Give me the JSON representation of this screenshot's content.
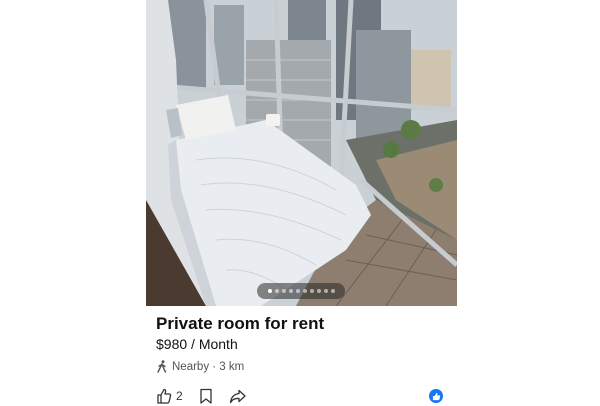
{
  "listing": {
    "title": "Private room for rent",
    "price": "$980 / Month",
    "location": "Nearby · 3 km",
    "like_count": "2"
  },
  "gallery": {
    "dot_count": 10,
    "active_index": 0
  },
  "icons": {
    "location": "walking-person-icon",
    "like": "thumbs-up-icon",
    "save": "bookmark-icon",
    "share": "share-arrow-icon",
    "reaction": "facebook-like-icon"
  },
  "colors": {
    "accent": "#1877f2",
    "text": "#111111",
    "muted": "#555555"
  }
}
